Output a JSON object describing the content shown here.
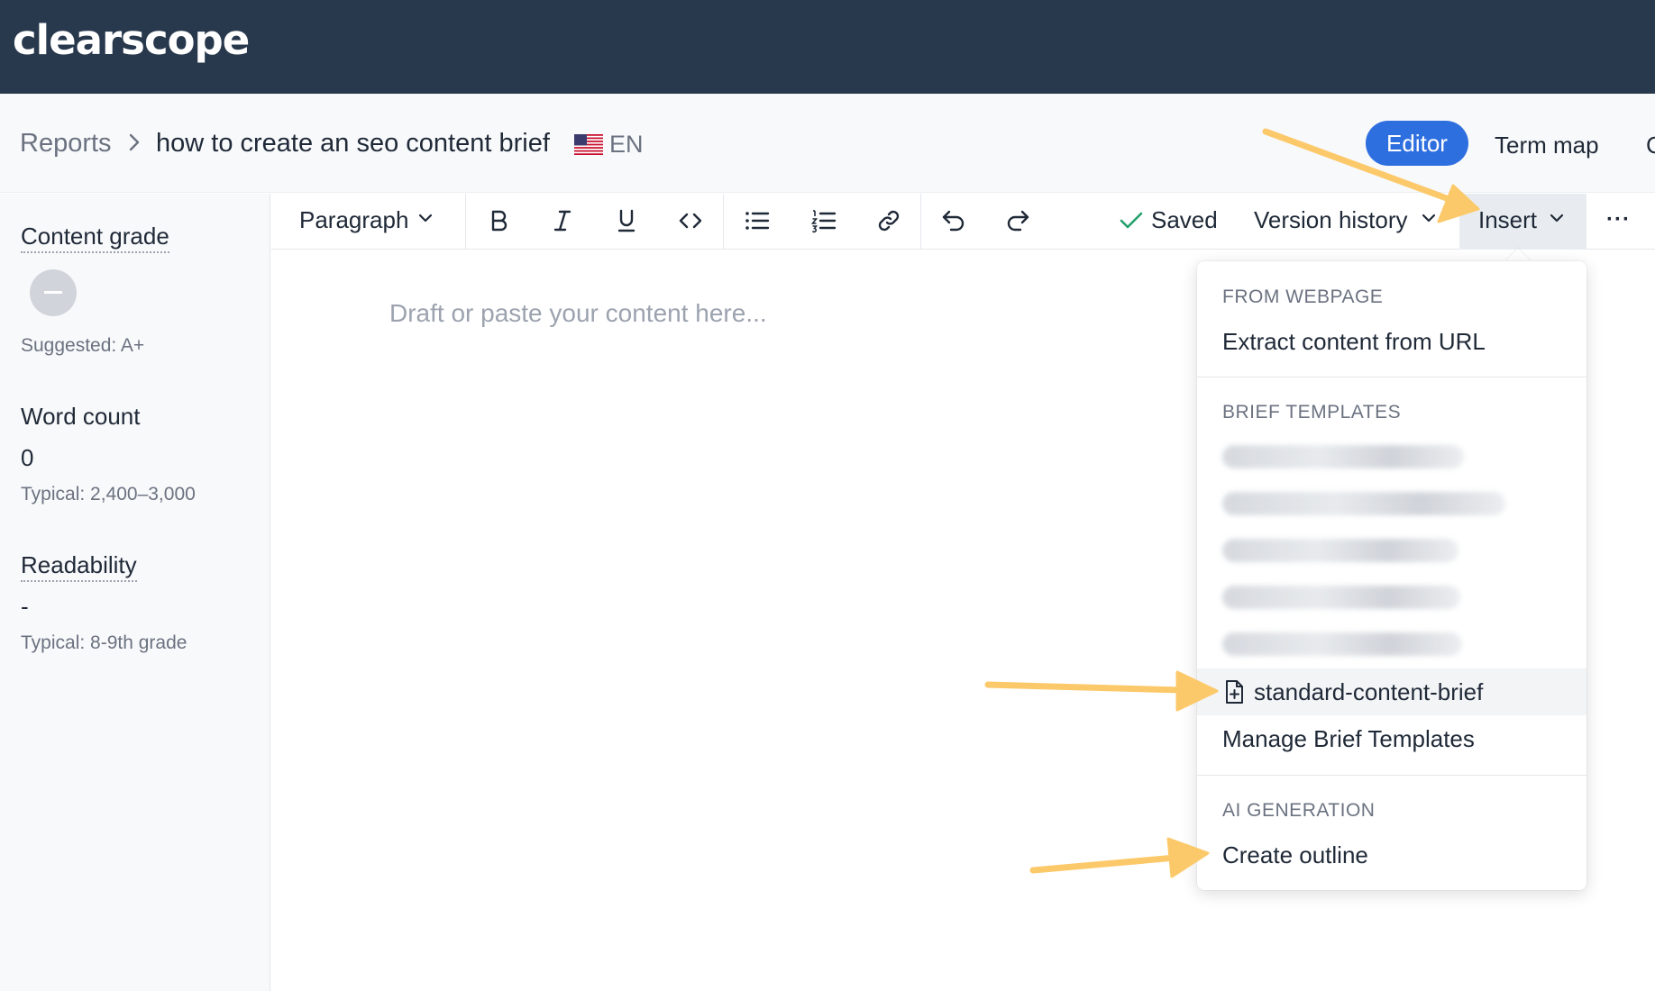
{
  "app": {
    "logo": "clearscope"
  },
  "breadcrumb": {
    "reports": "Reports",
    "title": "how to create an seo content brief",
    "language": "EN"
  },
  "view_tabs": {
    "editor": "Editor",
    "term_map": "Term map",
    "cut_off": "C"
  },
  "sidebar": {
    "content_grade": {
      "label": "Content grade",
      "suggested": "Suggested: A+"
    },
    "word_count": {
      "label": "Word count",
      "value": "0",
      "typical": "Typical: 2,400–3,000"
    },
    "readability": {
      "label": "Readability",
      "value": "-",
      "typical": "Typical: 8-9th grade"
    }
  },
  "toolbar": {
    "paragraph": "Paragraph",
    "saved": "Saved",
    "version_history": "Version history",
    "insert": "Insert",
    "more": "···"
  },
  "editor": {
    "placeholder": "Draft or paste your content here..."
  },
  "insert_menu": {
    "from_webpage_heading": "FROM WEBPAGE",
    "extract_url": "Extract content from URL",
    "brief_templates_heading": "BRIEF TEMPLATES",
    "standard_template": "standard-content-brief",
    "manage_templates": "Manage Brief Templates",
    "ai_generation_heading": "AI GENERATION",
    "create_outline": "Create outline"
  },
  "colors": {
    "topbar": "#28384d",
    "accent": "#2e6fdf",
    "annotation_arrow": "#fcc96a"
  }
}
